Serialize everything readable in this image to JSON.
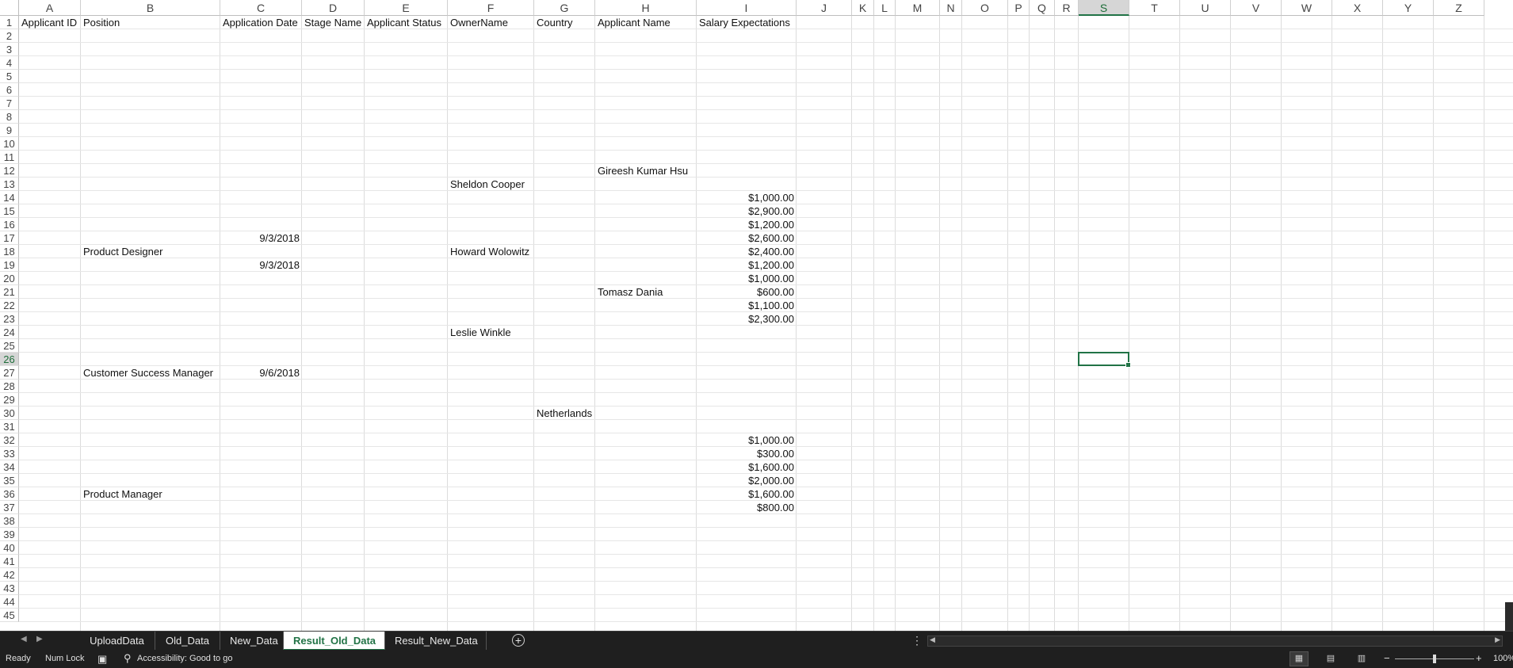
{
  "columns": [
    {
      "letter": "A"
    },
    {
      "letter": "B"
    },
    {
      "letter": "C"
    },
    {
      "letter": "D"
    },
    {
      "letter": "E"
    },
    {
      "letter": "F"
    },
    {
      "letter": "G"
    },
    {
      "letter": "H"
    },
    {
      "letter": "I"
    },
    {
      "letter": "J"
    },
    {
      "letter": "K"
    },
    {
      "letter": "L"
    },
    {
      "letter": "M"
    },
    {
      "letter": "N"
    },
    {
      "letter": "O"
    },
    {
      "letter": "P"
    },
    {
      "letter": "Q"
    },
    {
      "letter": "R"
    },
    {
      "letter": "S"
    },
    {
      "letter": "T"
    },
    {
      "letter": "U"
    },
    {
      "letter": "V"
    },
    {
      "letter": "W"
    },
    {
      "letter": "X"
    },
    {
      "letter": "Y"
    },
    {
      "letter": "Z"
    }
  ],
  "row_count": 45,
  "active_cell": {
    "col": "S",
    "row": 26
  },
  "headers": {
    "A": "Applicant ID",
    "B": "Position",
    "C": "Application Date",
    "D": "Stage Name",
    "E": "Applicant Status",
    "F": "OwnerName",
    "G": "Country",
    "H": "Applicant Name",
    "I": "Salary Expectations"
  },
  "cells": [
    {
      "col": "H",
      "row": 12,
      "text": "Gireesh Kumar  Hsu"
    },
    {
      "col": "F",
      "row": 13,
      "text": "Sheldon Cooper"
    },
    {
      "col": "I",
      "row": 14,
      "text": "$1,000.00",
      "align": "r"
    },
    {
      "col": "I",
      "row": 15,
      "text": "$2,900.00",
      "align": "r"
    },
    {
      "col": "I",
      "row": 16,
      "text": "$1,200.00",
      "align": "r"
    },
    {
      "col": "C",
      "row": 17,
      "text": "9/3/2018",
      "align": "r"
    },
    {
      "col": "I",
      "row": 17,
      "text": "$2,600.00",
      "align": "r"
    },
    {
      "col": "B",
      "row": 18,
      "text": "Product Designer"
    },
    {
      "col": "F",
      "row": 18,
      "text": "Howard Wolowitz"
    },
    {
      "col": "I",
      "row": 18,
      "text": "$2,400.00",
      "align": "r"
    },
    {
      "col": "C",
      "row": 19,
      "text": "9/3/2018",
      "align": "r"
    },
    {
      "col": "I",
      "row": 19,
      "text": "$1,200.00",
      "align": "r"
    },
    {
      "col": "I",
      "row": 20,
      "text": "$1,000.00",
      "align": "r"
    },
    {
      "col": "H",
      "row": 21,
      "text": "Tomasz  Dania"
    },
    {
      "col": "I",
      "row": 21,
      "text": "$600.00",
      "align": "r"
    },
    {
      "col": "I",
      "row": 22,
      "text": "$1,100.00",
      "align": "r"
    },
    {
      "col": "I",
      "row": 23,
      "text": "$2,300.00",
      "align": "r"
    },
    {
      "col": "F",
      "row": 24,
      "text": "Leslie Winkle"
    },
    {
      "col": "B",
      "row": 27,
      "text": "Customer Success Manager"
    },
    {
      "col": "C",
      "row": 27,
      "text": "9/6/2018",
      "align": "r"
    },
    {
      "col": "G",
      "row": 30,
      "text": "Netherlands"
    },
    {
      "col": "I",
      "row": 32,
      "text": "$1,000.00",
      "align": "r"
    },
    {
      "col": "I",
      "row": 33,
      "text": "$300.00",
      "align": "r"
    },
    {
      "col": "I",
      "row": 34,
      "text": "$1,600.00",
      "align": "r"
    },
    {
      "col": "I",
      "row": 35,
      "text": "$2,000.00",
      "align": "r"
    },
    {
      "col": "B",
      "row": 36,
      "text": "Product Manager"
    },
    {
      "col": "I",
      "row": 36,
      "text": "$1,600.00",
      "align": "r"
    },
    {
      "col": "I",
      "row": 37,
      "text": "$800.00",
      "align": "r"
    }
  ],
  "tabs": [
    {
      "label": "UploadData",
      "active": false
    },
    {
      "label": "Old_Data",
      "active": false
    },
    {
      "label": "New_Data",
      "active": false
    },
    {
      "label": "Result_Old_Data",
      "active": true
    },
    {
      "label": "Result_New_Data",
      "active": false
    }
  ],
  "status": {
    "ready": "Ready",
    "numlock": "Num Lock",
    "accessibility": "Accessibility: Good to go",
    "zoom": "100%"
  },
  "icons": {
    "add_sheet": "plus-circle-icon",
    "prev_sheet": "triangle-left-icon",
    "next_sheet": "triangle-right-icon",
    "more": "vertical-ellipsis-icon",
    "macro": "macro-record-icon",
    "accessibility": "accessibility-icon",
    "view_normal": "grid-view-icon",
    "view_page_layout": "page-layout-icon",
    "view_page_break": "page-break-icon"
  },
  "accent_color": "#217346"
}
